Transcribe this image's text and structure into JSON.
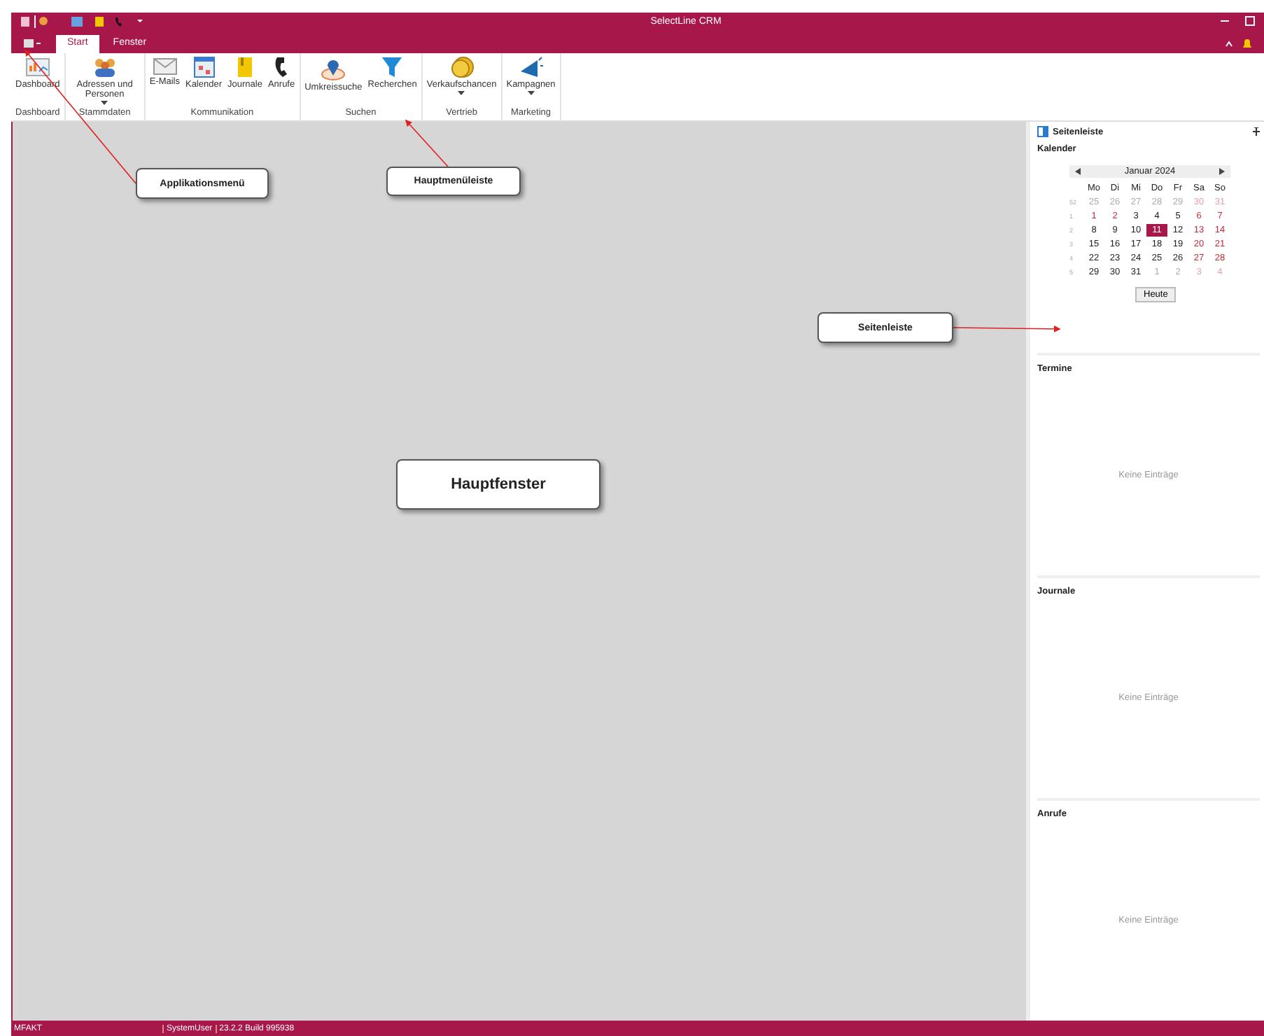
{
  "window": {
    "title": "SelectLine CRM"
  },
  "tabs": [
    {
      "label": "Start",
      "selected": true
    },
    {
      "label": "Fenster",
      "selected": false
    }
  ],
  "ribbon": {
    "groups": [
      {
        "label": "Dashboard",
        "buttons": [
          {
            "kind": "dashboard",
            "label": "Dashboard",
            "dropdown": false
          }
        ]
      },
      {
        "label": "Stammdaten",
        "buttons": [
          {
            "kind": "people",
            "label": "Adressen und Personen",
            "dropdown": true
          }
        ]
      },
      {
        "label": "Kommunikation",
        "buttons": [
          {
            "kind": "mail",
            "label": "E-Mails",
            "dropdown": false
          },
          {
            "kind": "calendar",
            "label": "Kalender",
            "dropdown": false
          },
          {
            "kind": "note",
            "label": "Journale",
            "dropdown": false
          },
          {
            "kind": "phone",
            "label": "Anrufe",
            "dropdown": false
          }
        ]
      },
      {
        "label": "Suchen",
        "buttons": [
          {
            "kind": "pin",
            "label": "Umkreissuche",
            "dropdown": false
          },
          {
            "kind": "funnel",
            "label": "Recherchen",
            "dropdown": false
          }
        ]
      },
      {
        "label": "Vertrieb",
        "buttons": [
          {
            "kind": "coins",
            "label": "Verkaufschancen",
            "dropdown": true
          }
        ]
      },
      {
        "label": "Marketing",
        "buttons": [
          {
            "kind": "megaphone",
            "label": "Kampagnen",
            "dropdown": true
          }
        ]
      }
    ]
  },
  "sidebar": {
    "title": "Seitenleiste",
    "calendar": {
      "heading": "Kalender",
      "month": "Januar 2024",
      "weekdays": [
        "Mo",
        "Di",
        "Mi",
        "Do",
        "Fr",
        "Sa",
        "So"
      ],
      "weeks": [
        {
          "number": "52",
          "days": [
            {
              "label": "25",
              "outside": true,
              "weekend": false,
              "selected": false
            },
            {
              "label": "26",
              "outside": true,
              "weekend": false,
              "selected": false
            },
            {
              "label": "27",
              "outside": true,
              "weekend": false,
              "selected": false
            },
            {
              "label": "28",
              "outside": true,
              "weekend": false,
              "selected": false
            },
            {
              "label": "29",
              "outside": true,
              "weekend": false,
              "selected": false
            },
            {
              "label": "30",
              "outside": true,
              "weekend": true,
              "selected": false
            },
            {
              "label": "31",
              "outside": true,
              "weekend": true,
              "selected": false
            }
          ]
        },
        {
          "number": "1",
          "days": [
            {
              "label": "1",
              "outside": false,
              "weekend": true,
              "selected": false
            },
            {
              "label": "2",
              "outside": false,
              "weekend": true,
              "selected": false
            },
            {
              "label": "3",
              "outside": false,
              "weekend": false,
              "selected": false
            },
            {
              "label": "4",
              "outside": false,
              "weekend": false,
              "selected": false
            },
            {
              "label": "5",
              "outside": false,
              "weekend": false,
              "selected": false
            },
            {
              "label": "6",
              "outside": false,
              "weekend": true,
              "selected": false
            },
            {
              "label": "7",
              "outside": false,
              "weekend": true,
              "selected": false
            }
          ]
        },
        {
          "number": "2",
          "days": [
            {
              "label": "8",
              "outside": false,
              "weekend": false,
              "selected": false
            },
            {
              "label": "9",
              "outside": false,
              "weekend": false,
              "selected": false
            },
            {
              "label": "10",
              "outside": false,
              "weekend": false,
              "selected": false
            },
            {
              "label": "11",
              "outside": false,
              "weekend": false,
              "selected": true
            },
            {
              "label": "12",
              "outside": false,
              "weekend": false,
              "selected": false
            },
            {
              "label": "13",
              "outside": false,
              "weekend": true,
              "selected": false
            },
            {
              "label": "14",
              "outside": false,
              "weekend": true,
              "selected": false
            }
          ]
        },
        {
          "number": "3",
          "days": [
            {
              "label": "15",
              "outside": false,
              "weekend": false,
              "selected": false
            },
            {
              "label": "16",
              "outside": false,
              "weekend": false,
              "selected": false
            },
            {
              "label": "17",
              "outside": false,
              "weekend": false,
              "selected": false
            },
            {
              "label": "18",
              "outside": false,
              "weekend": false,
              "selected": false
            },
            {
              "label": "19",
              "outside": false,
              "weekend": false,
              "selected": false
            },
            {
              "label": "20",
              "outside": false,
              "weekend": true,
              "selected": false
            },
            {
              "label": "21",
              "outside": false,
              "weekend": true,
              "selected": false
            }
          ]
        },
        {
          "number": "4",
          "days": [
            {
              "label": "22",
              "outside": false,
              "weekend": false,
              "selected": false
            },
            {
              "label": "23",
              "outside": false,
              "weekend": false,
              "selected": false
            },
            {
              "label": "24",
              "outside": false,
              "weekend": false,
              "selected": false
            },
            {
              "label": "25",
              "outside": false,
              "weekend": false,
              "selected": false
            },
            {
              "label": "26",
              "outside": false,
              "weekend": false,
              "selected": false
            },
            {
              "label": "27",
              "outside": false,
              "weekend": true,
              "selected": false
            },
            {
              "label": "28",
              "outside": false,
              "weekend": true,
              "selected": false
            }
          ]
        },
        {
          "number": "5",
          "days": [
            {
              "label": "29",
              "outside": false,
              "weekend": false,
              "selected": false
            },
            {
              "label": "30",
              "outside": false,
              "weekend": false,
              "selected": false
            },
            {
              "label": "31",
              "outside": false,
              "weekend": false,
              "selected": false
            },
            {
              "label": "1",
              "outside": true,
              "weekend": false,
              "selected": false
            },
            {
              "label": "2",
              "outside": true,
              "weekend": false,
              "selected": false
            },
            {
              "label": "3",
              "outside": true,
              "weekend": true,
              "selected": false
            },
            {
              "label": "4",
              "outside": true,
              "weekend": true,
              "selected": false
            }
          ]
        }
      ],
      "today_button": "Heute"
    },
    "sections": [
      {
        "heading": "Termine",
        "empty_text": "Keine Einträge"
      },
      {
        "heading": "Journale",
        "empty_text": "Keine Einträge"
      },
      {
        "heading": "Anrufe",
        "empty_text": "Keine Einträge"
      }
    ]
  },
  "callouts": [
    "Applikationsmenü",
    "Hauptmenüleiste",
    "Seitenleiste",
    "Hauptfenster"
  ],
  "status_bar": [
    "MFAKT",
    "SystemUser",
    "23.2.2 Build 995938"
  ]
}
